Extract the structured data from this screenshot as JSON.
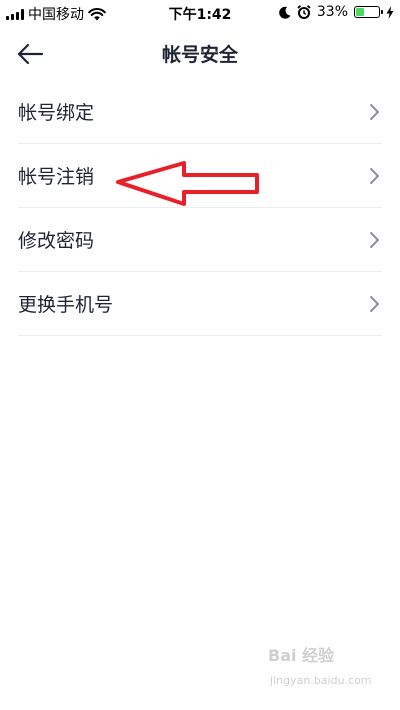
{
  "status_bar": {
    "carrier": "中国移动",
    "time": "下午1:42",
    "battery_percent": "33%",
    "battery_level": 0.33,
    "icons": [
      "signal-icon",
      "wifi-icon",
      "moon-icon",
      "alarm-icon",
      "battery-icon",
      "charging-icon"
    ]
  },
  "nav": {
    "title": "帐号安全",
    "back_icon": "back-arrow-icon"
  },
  "settings": {
    "items": [
      {
        "label": "帐号绑定"
      },
      {
        "label": "帐号注销"
      },
      {
        "label": "修改密码"
      },
      {
        "label": "更换手机号"
      }
    ],
    "chevron_icon": "chevron-right-icon"
  },
  "annotation": {
    "arrow_color": "#e8202a"
  },
  "watermark": {
    "brand": "Bai 经验",
    "url": "jingyan.baidu.com"
  },
  "colors": {
    "text": "#1f2432",
    "divider": "#ececec",
    "chevron": "#8a8f99",
    "battery_fill": "#4cd964"
  }
}
